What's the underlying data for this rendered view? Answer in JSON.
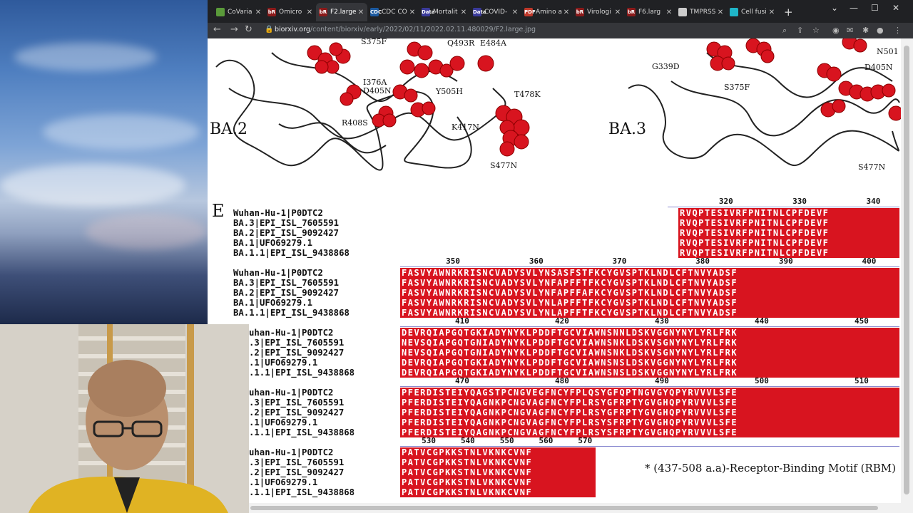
{
  "browser": {
    "tabs": [
      {
        "label": "CoVaria",
        "fav": "",
        "favcolor": "#5a9a3a"
      },
      {
        "label": "Omicro",
        "fav": "bR",
        "favcolor": "#8b1a1a"
      },
      {
        "label": "F2.large",
        "fav": "bR",
        "favcolor": "#8b1a1a"
      },
      {
        "label": "CDC CO",
        "fav": "CDC",
        "favcolor": "#1c5aa0"
      },
      {
        "label": "Mortalit",
        "fav": "Data",
        "favcolor": "#3a3a9a"
      },
      {
        "label": "COVID-",
        "fav": "Data",
        "favcolor": "#3a3a9a"
      },
      {
        "label": "Amino a",
        "fav": "PDF",
        "favcolor": "#c0392b"
      },
      {
        "label": "Virologi",
        "fav": "bR",
        "favcolor": "#8b1a1a"
      },
      {
        "label": "F6.larg",
        "fav": "bR",
        "favcolor": "#8b1a1a"
      },
      {
        "label": "TMPRSS",
        "fav": "",
        "favcolor": "#cccccc"
      },
      {
        "label": "Cell fusi",
        "fav": "",
        "favcolor": "#1fb5c8"
      }
    ],
    "new_tab": "+",
    "url_domain": "biorxiv.org",
    "url_path": "/content/biorxiv/early/2022/02/11/2022.02.11.480029/F2.large.jpg"
  },
  "figure": {
    "labels": {
      "ba2": "BA.2",
      "ba3": "BA.3",
      "panel_e": "E"
    },
    "ba2_mutations": [
      "S375F",
      "Q493R",
      "E484A",
      "I376A",
      "D405N",
      "Y505H",
      "T478K",
      "R408S",
      "K417N",
      "S477N"
    ],
    "ba3_mutations": [
      "G339D",
      "N501",
      "D405N",
      "S375F",
      "S477N"
    ],
    "sequence_names": [
      "Wuhan-Hu-1|P0DTC2",
      "BA.3|EPI_ISL_7605591",
      "BA.2|EPI_ISL_9092427",
      "BA.1|UFO69279.1",
      "BA.1.1|EPI_ISL_9438868"
    ],
    "sequence_names_cut": [
      "uhan-Hu-1|P0DTC2",
      ".3|EPI_ISL_7605591",
      ".2|EPI_ISL_9092427",
      ".1|UFO69279.1",
      ".1.1|EPI_ISL_9438868"
    ],
    "block1": {
      "numbers": [
        "320",
        "330",
        "340"
      ],
      "rows": [
        "RVQPTESIVRFPNITNLCPFDEVF",
        "RVQPTESIVRFPNITNLCPFDEVF",
        "RVQPTESIVRFPNITNLCPFDEVF",
        "RVQPTESIVRFPNITNLCPFDEVF",
        "RVQPTESIVRFPNITNLCPFDEVF"
      ]
    },
    "block2": {
      "numbers": [
        "350",
        "360",
        "370",
        "380",
        "390",
        "400"
      ],
      "rows": [
        "FASVYAWNRKRISNCVADYSVLYNSASFSTFKCYGVSPTKLNDLCFTNVYADSF",
        "FASVYAWNRKRISNCVADYSVLYNFAPFFTFKCYGVSPTKLNDLCFTNVYADSF",
        "FASVYAWNRKRISNCVADYSVLYNFAPFFAFKCYGVSPTKLNDLCFTNVYADSF",
        "FASVYAWNRKRISNCVADYSVLYNLAPFFTFKCYGVSPTKLNDLCFTNVYADSF",
        "FASVYAWNRKRISNCVADYSVLYNLAPFFTFKCYGVSPTKLNDLCFTNVYADSF"
      ]
    },
    "block3": {
      "numbers": [
        "410",
        "420",
        "430",
        "440",
        "450"
      ],
      "rows": [
        "DEVRQIAPGQTGKIADYNYKLPDDFTGCVIAWNSNNLDSKVGGNYNYLYRLFRK",
        "NEVSQIAPGQTGNIADYNYKLPDDFTGCVIAWNSNKLDSKVSGNYNYLYRLFRK",
        "NEVSQIAPGQTGNIADYNYKLPDDFTGCVIAWNSNKLDSKVSGNYNYLYRLFRK",
        "DEVRQIAPGQTGKIADYNYKLPDDFTGCVIAWNSNSLDSKVGGNYNYLYRLFRK",
        "DEVRQIAPGQTGKIADYNYKLPDDFTGCVIAWNSNSLDSKVGGNYNYLYRLFRK"
      ]
    },
    "block4": {
      "numbers": [
        "470",
        "480",
        "490",
        "500",
        "510"
      ],
      "rows": [
        "PFERDISTEIYQAGSTPCNGVEGFNCYFPLQSYGFQPTNGVGYQPYRVVVLSFE",
        "PFERDISTEIYQAGNKPCNGVAGFNCYFPLRSYGFRPTYGVGHQPYRVVVLSFE",
        "PFERDISTEIYQAGNKPCNGVAGFNCYFPLRSYGFRPTYGVGHQPYRVVVLSFE",
        "PFERDISTEIYQAGNKPCNGVAGFNCYFPLRSYSFRPTYGVGHQPYRVVVLSFE",
        "PFERDISTEIYQAGNKPCNGVAGFNCYFPLRSYSFRPTYGVGHQPYRVVVLSFE"
      ]
    },
    "block5": {
      "numbers": [
        "530",
        "540",
        "550",
        "560",
        "570"
      ],
      "rows": [
        "PATVCGPKKSTNLVKNKCVNF",
        "PATVCGPKKSTNLVKNKCVNF",
        "PATVCGPKKSTNLVKNKCVNF",
        "PATVCGPKKSTNLVKNKCVNF",
        "PATVCGPKKSTNLVKNKCVNF"
      ]
    },
    "rbm_note": "* (437-508 a.a)-Receptor-Binding Motif (RBM)"
  }
}
